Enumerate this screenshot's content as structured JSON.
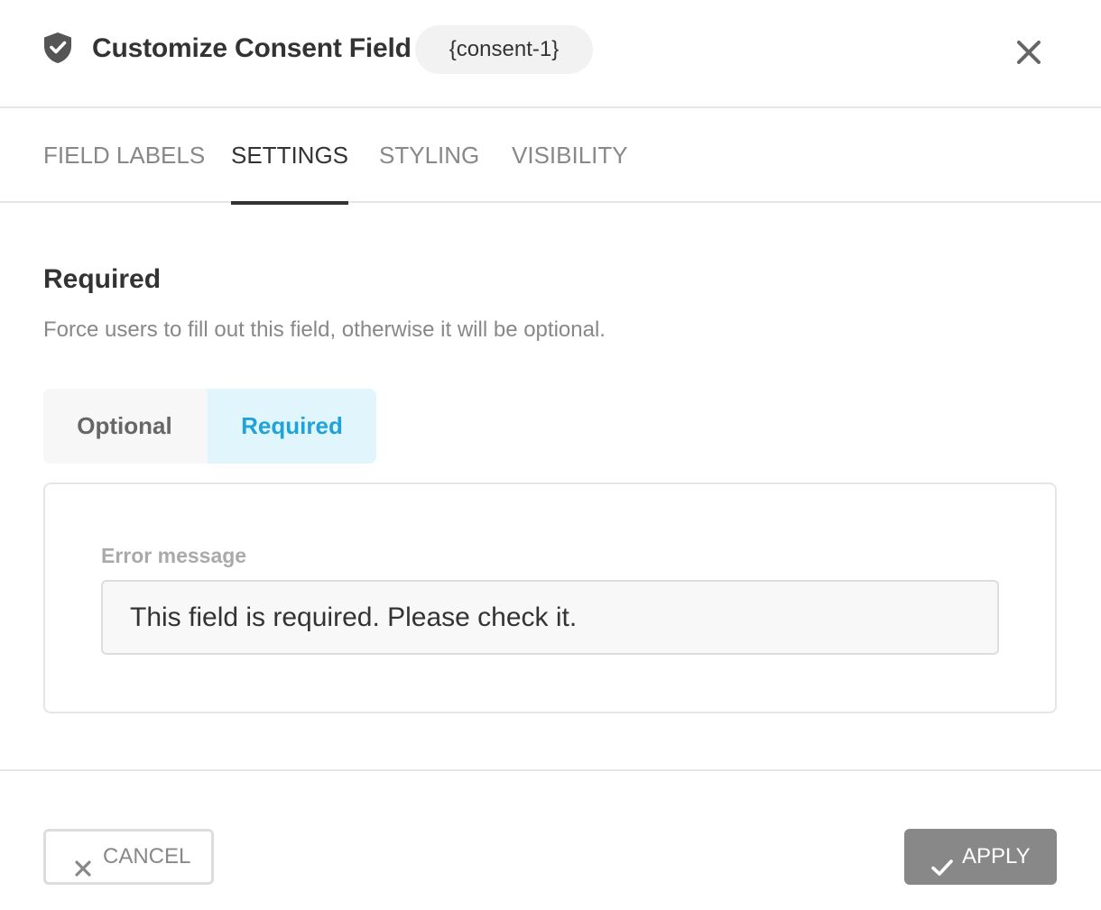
{
  "header": {
    "title": "Customize Consent Field",
    "tag": "{consent-1}"
  },
  "tabs": [
    {
      "label": "FIELD LABELS",
      "active": false
    },
    {
      "label": "SETTINGS",
      "active": true
    },
    {
      "label": "STYLING",
      "active": false
    },
    {
      "label": "VISIBILITY",
      "active": false
    }
  ],
  "required_section": {
    "title": "Required",
    "description": "Force users to fill out this field, otherwise it will be optional.",
    "options": [
      {
        "label": "Optional",
        "selected": false
      },
      {
        "label": "Required",
        "selected": true
      }
    ],
    "error_message": {
      "label": "Error message",
      "value": "This field is required. Please check it."
    }
  },
  "footer": {
    "cancel_label": "CANCEL",
    "apply_label": "APPLY"
  },
  "colors": {
    "accent": "#1fa3d8",
    "accent_bg": "#e1f5fc",
    "apply_bg": "#888888",
    "text_dark": "#333333",
    "text_muted": "#888888"
  },
  "icons": {
    "header": "shield-check-icon",
    "close": "close-icon",
    "cancel": "x-icon",
    "apply": "checkmark-icon"
  }
}
